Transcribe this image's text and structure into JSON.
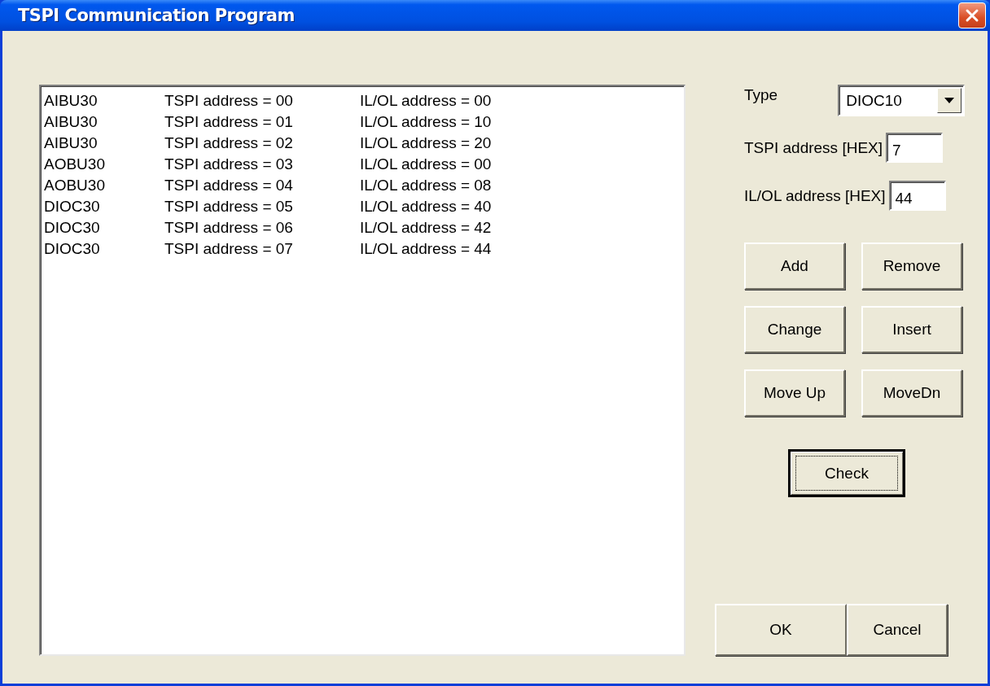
{
  "window": {
    "title": "TSPI Communication Program"
  },
  "list": {
    "rows": [
      {
        "type": "AIBU30",
        "tspi": "TSPI address = 00",
        "ilol": "IL/OL address = 00"
      },
      {
        "type": "AIBU30",
        "tspi": "TSPI address = 01",
        "ilol": "IL/OL address = 10"
      },
      {
        "type": "AIBU30",
        "tspi": "TSPI address = 02",
        "ilol": "IL/OL address = 20"
      },
      {
        "type": "AOBU30",
        "tspi": "TSPI address = 03",
        "ilol": "IL/OL address = 00"
      },
      {
        "type": "AOBU30",
        "tspi": "TSPI address = 04",
        "ilol": "IL/OL address = 08"
      },
      {
        "type": "DIOC30",
        "tspi": "TSPI address = 05",
        "ilol": "IL/OL address = 40"
      },
      {
        "type": "DIOC30",
        "tspi": "TSPI address = 06",
        "ilol": "IL/OL address = 42"
      },
      {
        "type": "DIOC30",
        "tspi": "TSPI address = 07",
        "ilol": "IL/OL address = 44"
      }
    ]
  },
  "form": {
    "type": {
      "label": "Type",
      "value": "DIOC10"
    },
    "tspi_address": {
      "label": "TSPI address [HEX]",
      "value": "7"
    },
    "ilol_address": {
      "label": "IL/OL address [HEX]",
      "value": "44"
    }
  },
  "edit_buttons": [
    {
      "label": "Add"
    },
    {
      "label": "Remove"
    },
    {
      "label": "Change"
    },
    {
      "label": "Insert"
    },
    {
      "label": "Move Up"
    },
    {
      "label": "MoveDn"
    }
  ],
  "check_button": {
    "label": "Check",
    "focused": true
  },
  "dialog_buttons": [
    {
      "label": "OK"
    },
    {
      "label": "Cancel"
    }
  ]
}
